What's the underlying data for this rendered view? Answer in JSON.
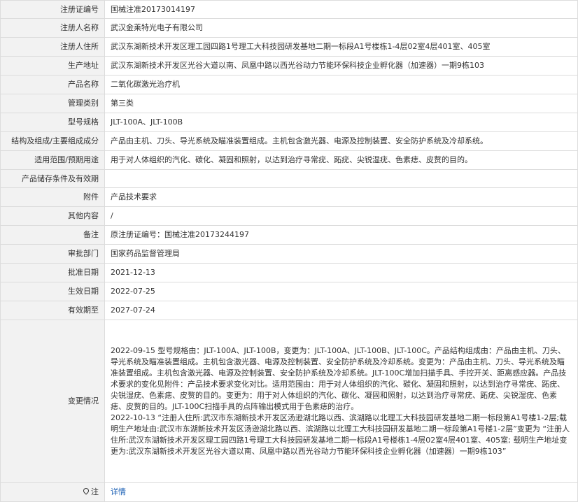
{
  "rows": [
    {
      "label": "注册证编号",
      "value": "国械注准20173014197"
    },
    {
      "label": "注册人名称",
      "value": "武汉金莱特光电子有限公司"
    },
    {
      "label": "注册人住所",
      "value": "武汉东湖新技术开发区理工园四路1号理工大科技园研发基地二期一标段A1号楼栋1-4层02室4层401室、405室"
    },
    {
      "label": "生产地址",
      "value": "武汉东湖新技术开发区光谷大道以南、凤凰中路以西光谷动力节能环保科技企业孵化器（加速器）一期9栋103"
    },
    {
      "label": "产品名称",
      "value": "二氧化碳激光治疗机"
    },
    {
      "label": "管理类别",
      "value": "第三类"
    },
    {
      "label": "型号规格",
      "value": "JLT-100A、JLT-100B"
    },
    {
      "label": "结构及组成/主要组成成分",
      "value": "产品由主机、刀头、导光系统及瞄准装置组成。主机包含激光器、电源及控制装置、安全防护系统及冷却系统。"
    },
    {
      "label": "适用范围/预期用途",
      "value": "用于对人体组织的汽化、碳化、凝固和照射，以达到治疗寻常疣、跖疣、尖锐湿疣、色素痣、皮赘的目的。"
    },
    {
      "label": "产品储存条件及有效期",
      "value": ""
    },
    {
      "label": "附件",
      "value": "产品技术要求"
    },
    {
      "label": "其他内容",
      "value": "/"
    },
    {
      "label": "备注",
      "value": "原注册证编号：国械注准20173244197"
    },
    {
      "label": "审批部门",
      "value": "国家药品监督管理局"
    },
    {
      "label": "批准日期",
      "value": "2021-12-13"
    },
    {
      "label": "生效日期",
      "value": "2022-07-25"
    },
    {
      "label": "有效期至",
      "value": "2027-07-24"
    }
  ],
  "changes": {
    "label": "变更情况",
    "entry1": "2022-09-15 型号规格由：JLT-100A、JLT-100B，变更为：JLT-100A、JLT-100B、JLT-100C。产品结构组成由：产品由主机、刀头、导光系统及瞄准装置组成。主机包含激光器、电源及控制装置、安全防护系统及冷却系统。变更为：产品由主机、刀头、导光系统及瞄准装置组成。主机包含激光器、电源及控制装置、安全防护系统及冷却系统。JLT-100C增加扫描手具、手控开关、距离感应器。产品技术要求的变化见附件：产品技术要求变化对比。适用范围由：用于对人体组织的汽化、碳化、凝固和照射，以达到治疗寻常疣、跖疣、尖锐湿疣、色素痣、皮赘的目的。变更为：用于对人体组织的汽化、碳化、凝固和照射，以达到治疗寻常疣、跖疣、尖锐湿疣、色素痣、皮赘的目的。JLT-100C扫描手具的点阵输出模式用于色素痣的治疗。",
    "entry2": "2022-10-13 “注册人住所:武汉市东湖新技术开发区汤逊湖北路以西、滨湖路以北理工大科技园研发基地二期一标段第A1号楼1-2层;载明生产地址由:武汉市东湖新技术开发区汤逊湖北路以西、滨湖路以北理工大科技园研发基地二期一标段第A1号楼1-2层”变更为 “注册人住所:武汉东湖新技术开发区理工园四路1号理工大科技园研发基地二期一标段A1号楼栋1-4层02室4层401室、405室; 载明生产地址变更为:武汉东湖新技术开发区光谷大道以南、凤凰中路以西光谷动力节能环保科技企业孵化器（加速器）一期9栋103”"
  },
  "note": {
    "label": "注",
    "link": "详情",
    "icon": "location-pin-icon"
  }
}
